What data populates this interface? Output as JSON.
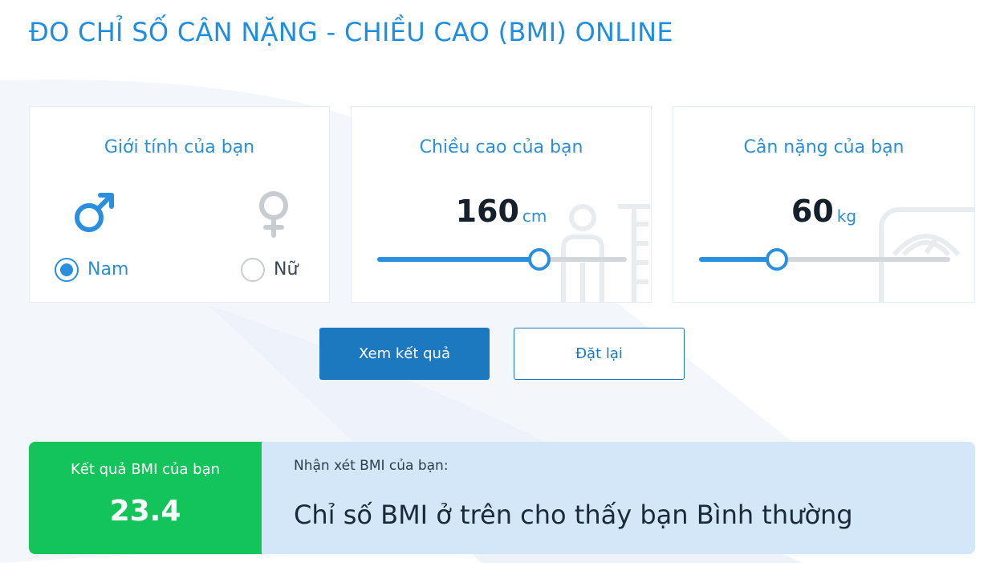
{
  "page": {
    "title": "ĐO CHỈ SỐ CÂN NẶNG - CHIỀU CAO (BMI) ONLINE"
  },
  "gender_card": {
    "title": "Giới tính của bạn",
    "options": [
      {
        "label": "Nam",
        "icon": "male-icon",
        "selected": true
      },
      {
        "label": "Nữ",
        "icon": "female-icon",
        "selected": false
      }
    ]
  },
  "height_card": {
    "title": "Chiều cao của bạn",
    "value": "160",
    "unit": "cm",
    "slider_fraction": 0.65
  },
  "weight_card": {
    "title": "Cân nặng của bạn",
    "value": "60",
    "unit": "kg",
    "slider_fraction": 0.31
  },
  "actions": {
    "submit_label": "Xem kết quả",
    "reset_label": "Đặt lại"
  },
  "result": {
    "label": "Kết quả BMI của bạn",
    "value": "23.4",
    "comment_label": "Nhận xét BMI của bạn:",
    "comment_text": "Chỉ số BMI ở trên cho thấy bạn Bình thường"
  },
  "colors": {
    "accent": "#1e8fe0",
    "primary_button": "#1c78bf",
    "result_green": "#13c45a",
    "result_panel": "#d3e7f8"
  }
}
